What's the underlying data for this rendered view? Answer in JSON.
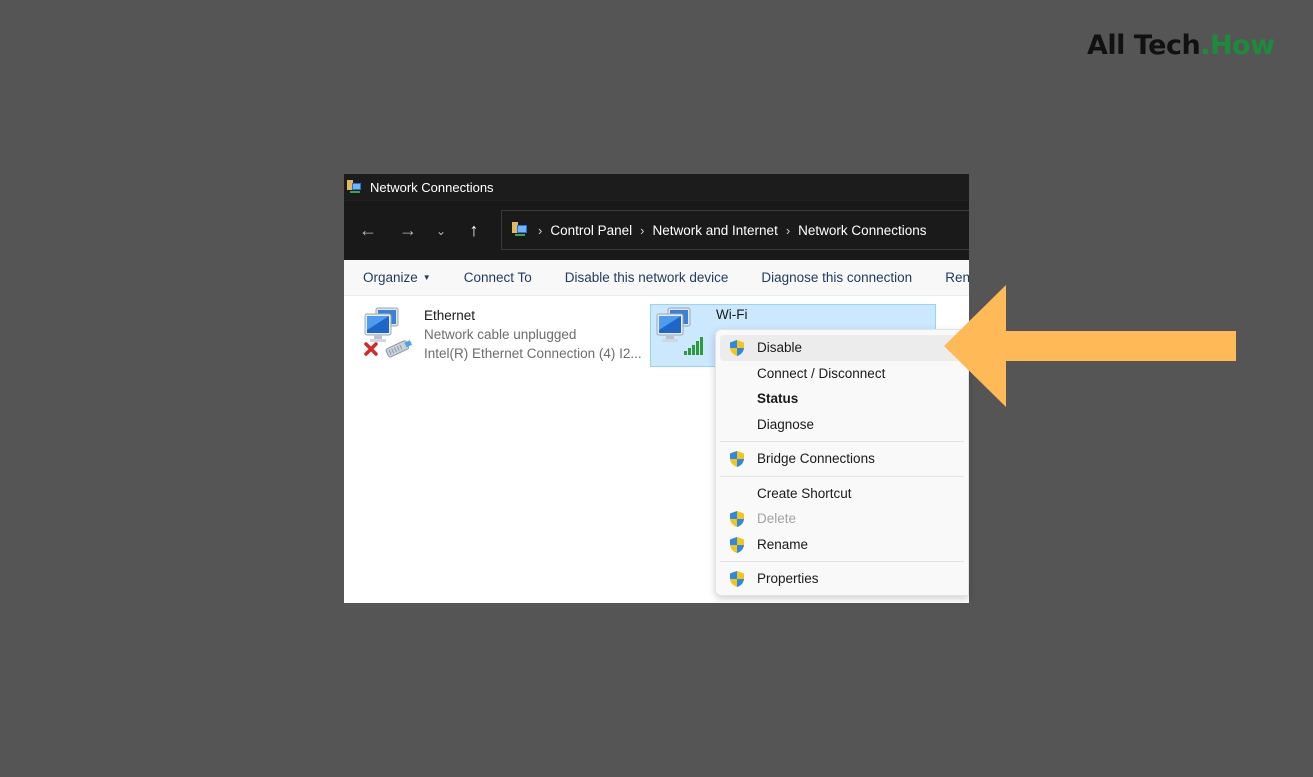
{
  "watermark": {
    "text_main": "All Tech",
    "text_accent": ".How",
    "accent_color": "#1e8a3c"
  },
  "window": {
    "title": "Network Connections",
    "title_icon": "network-connections-icon"
  },
  "navigation": {
    "back_icon": "←",
    "forward_icon": "→",
    "recent_icon": "⌄",
    "up_icon": "↑",
    "breadcrumb": [
      "Control Panel",
      "Network and Internet",
      "Network Connections"
    ],
    "separator": "›"
  },
  "toolbar": {
    "items": [
      {
        "label": "Organize",
        "has_dropdown": true
      },
      {
        "label": "Connect To"
      },
      {
        "label": "Disable this network device"
      },
      {
        "label": "Diagnose this connection"
      },
      {
        "label": "Rename this connection"
      }
    ]
  },
  "connections": [
    {
      "name": "Ethernet",
      "status": "Network cable unplugged",
      "adapter": "Intel(R) Ethernet Connection (4) I2...",
      "icon": "ethernet-disconnected-icon",
      "selected": false
    },
    {
      "name": "Wi-Fi",
      "icon": "wifi-adapter-icon",
      "selected": true
    }
  ],
  "context_menu": {
    "groups": [
      [
        {
          "label": "Disable",
          "shield": true,
          "highlighted": true
        },
        {
          "label": "Connect / Disconnect"
        },
        {
          "label": "Status",
          "bold": true
        },
        {
          "label": "Diagnose"
        }
      ],
      [
        {
          "label": "Bridge Connections",
          "shield": true
        }
      ],
      [
        {
          "label": "Create Shortcut"
        },
        {
          "label": "Delete",
          "shield": true,
          "disabled": true
        },
        {
          "label": "Rename",
          "shield": true
        }
      ],
      [
        {
          "label": "Properties",
          "shield": true
        }
      ]
    ]
  },
  "annotation": {
    "type": "arrow-left",
    "color": "#ffb957",
    "points_to": "Disable"
  }
}
